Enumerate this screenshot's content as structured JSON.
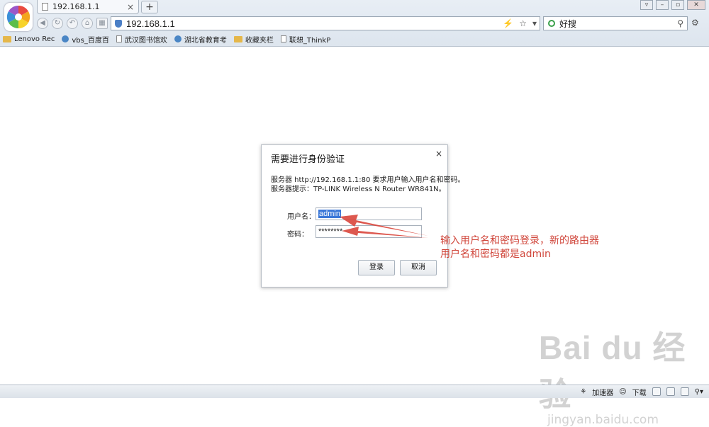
{
  "browser": {
    "tab_title": "192.168.1.1",
    "new_tab_label": "+",
    "tab_close": "×",
    "address": "192.168.1.1",
    "search_text": "好搜",
    "icons": [
      "logo-icon",
      "back-icon",
      "refresh-icon",
      "undo-icon",
      "home-icon",
      "grid-icon",
      "bolt-icon",
      "star-icon",
      "dropdown-icon",
      "search-icon",
      "wrench-icon"
    ]
  },
  "bookmarks": [
    {
      "label": "Lenovo Rec",
      "icon": "folder-icon"
    },
    {
      "label": "vbs_百度百",
      "icon": "globe-icon"
    },
    {
      "label": "武汉图书馆欢",
      "icon": "page-icon"
    },
    {
      "label": "湖北省教育考",
      "icon": "globe-icon"
    },
    {
      "label": "收藏夹栏",
      "icon": "folder-icon"
    },
    {
      "label": "联想_ThinkP",
      "icon": "page-icon"
    }
  ],
  "dialog": {
    "title": "需要进行身份验证",
    "close": "×",
    "message_line1": "服务器 http://192.168.1.1:80 要求用户输入用户名和密码。",
    "message_line2": "服务器提示：TP-LINK Wireless N Router WR841N。",
    "username_label": "用户名：",
    "username_value": "admin",
    "password_label": "密码：",
    "password_value": "********",
    "login_button": "登录",
    "cancel_button": "取消"
  },
  "annotation": {
    "line1": "输入用户名和密码登录，新的路由器",
    "line2": "用户名和密码都是admin",
    "color": "#d0453a"
  },
  "statusbar": {
    "accelerator": "加速器",
    "download": "下载"
  },
  "watermark": {
    "main": "Bai du 经验",
    "sub": "jingyan.baidu.com"
  }
}
